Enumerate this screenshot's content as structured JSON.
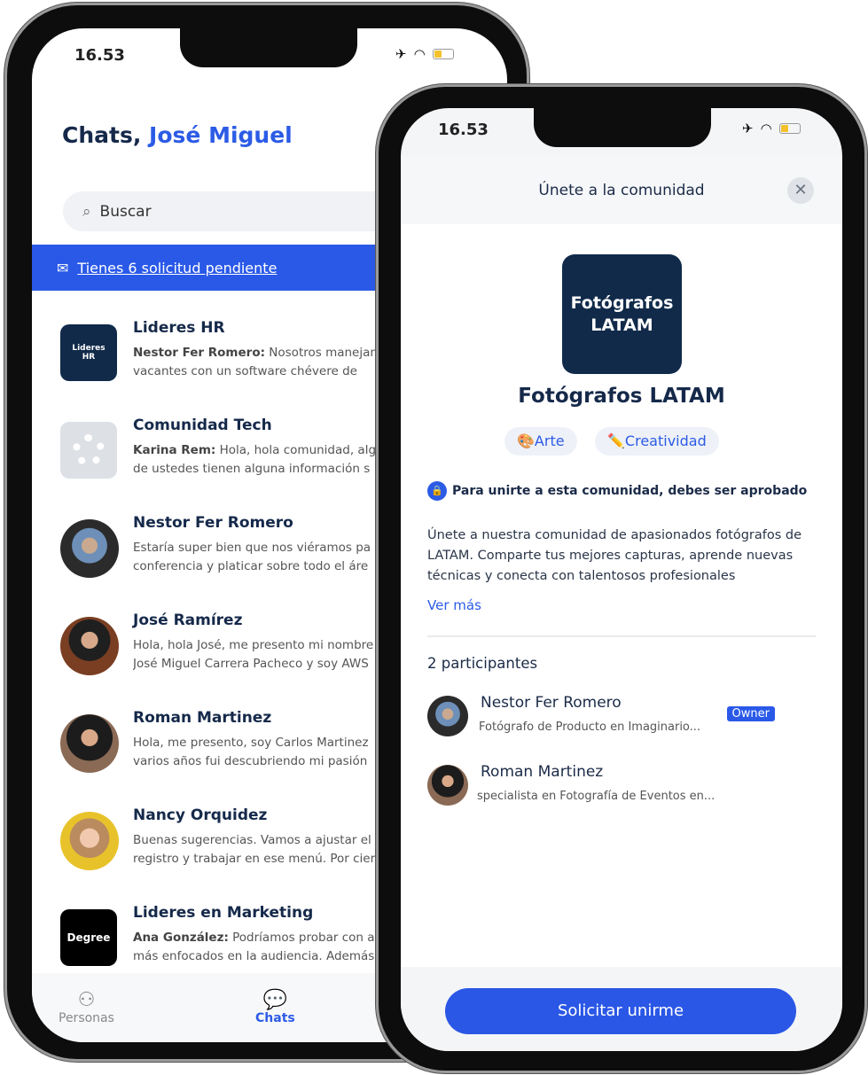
{
  "phone1": {
    "time": "16.53",
    "title_prefix": "Chats, ",
    "title_name": "José Miguel",
    "search_placeholder": "Buscar",
    "banner": "Tienes 6 solicitud pendiente",
    "chats": [
      {
        "name": "Lideres HR",
        "avatar_text": "Lideres HR",
        "sender": "Nestor Fer Romero:",
        "msg1": " Nosotros manejam",
        "msg2": "vacantes con un software chévere de"
      },
      {
        "name": "Comunidad Tech",
        "sender": "Karina Rem:",
        "msg1": " Hola, hola comunidad, alg",
        "msg2": "de ustedes tienen alguna información s"
      },
      {
        "name": "Nestor Fer Romero",
        "sender": "",
        "msg1": "Estaría super bien que nos viéramos pa",
        "msg2": "conferencia y platicar sobre todo el áre"
      },
      {
        "name": "José Ramírez",
        "sender": "",
        "msg1": "Hola, hola José, me presento mi nombre",
        "msg2": "José Miguel Carrera Pacheco y soy AWS"
      },
      {
        "name": "Roman Martinez",
        "sender": "",
        "msg1": "Hola, me presento, soy Carlos Martinez",
        "msg2": "varios años fui descubriendo mi pasión"
      },
      {
        "name": "Nancy Orquidez",
        "sender": "",
        "msg1": "Buenas sugerencias. Vamos a ajustar el",
        "msg2": "registro y trabajar en ese menú. Por cier"
      },
      {
        "name": "Lideres en Marketing",
        "avatar_text": "Degree",
        "sender": "Ana González:",
        "msg1": " Podríamos probar con a",
        "msg2": "más enfocados en la audiencia. Además"
      }
    ],
    "tabs": [
      {
        "label": "Personas",
        "icon": "people-icon"
      },
      {
        "label": "Chats",
        "icon": "chat-bubbles-icon",
        "active": true
      }
    ]
  },
  "phone2": {
    "time": "16.53",
    "header": "Únete a la comunidad",
    "logo_text": "Fotógrafos LATAM",
    "community_name": "Fotógrafos LATAM",
    "tags": [
      {
        "emoji": "🎨",
        "label": "Arte"
      },
      {
        "emoji": "✏️",
        "label": "Creatividad"
      }
    ],
    "notice": "Para unirte a esta comunidad, debes ser aprobado",
    "description": "Únete a nuestra comunidad de apasionados fotógrafos de LATAM. Comparte tus mejores capturas, aprende nuevas técnicas y conecta con talentosos profesionales",
    "see_more": "Ver más",
    "participants_title": "2 participantes",
    "participants": [
      {
        "name": "Nestor Fer Romero",
        "role": "Fotógrafo de Producto en Imaginario...",
        "badge": "Owner"
      },
      {
        "name": "Roman Martinez",
        "role": "specialista en Fotografía de Eventos en..."
      }
    ],
    "cta": "Solicitar unirme"
  },
  "colors": {
    "accent": "#2a59e8",
    "navy": "#112a4a"
  }
}
